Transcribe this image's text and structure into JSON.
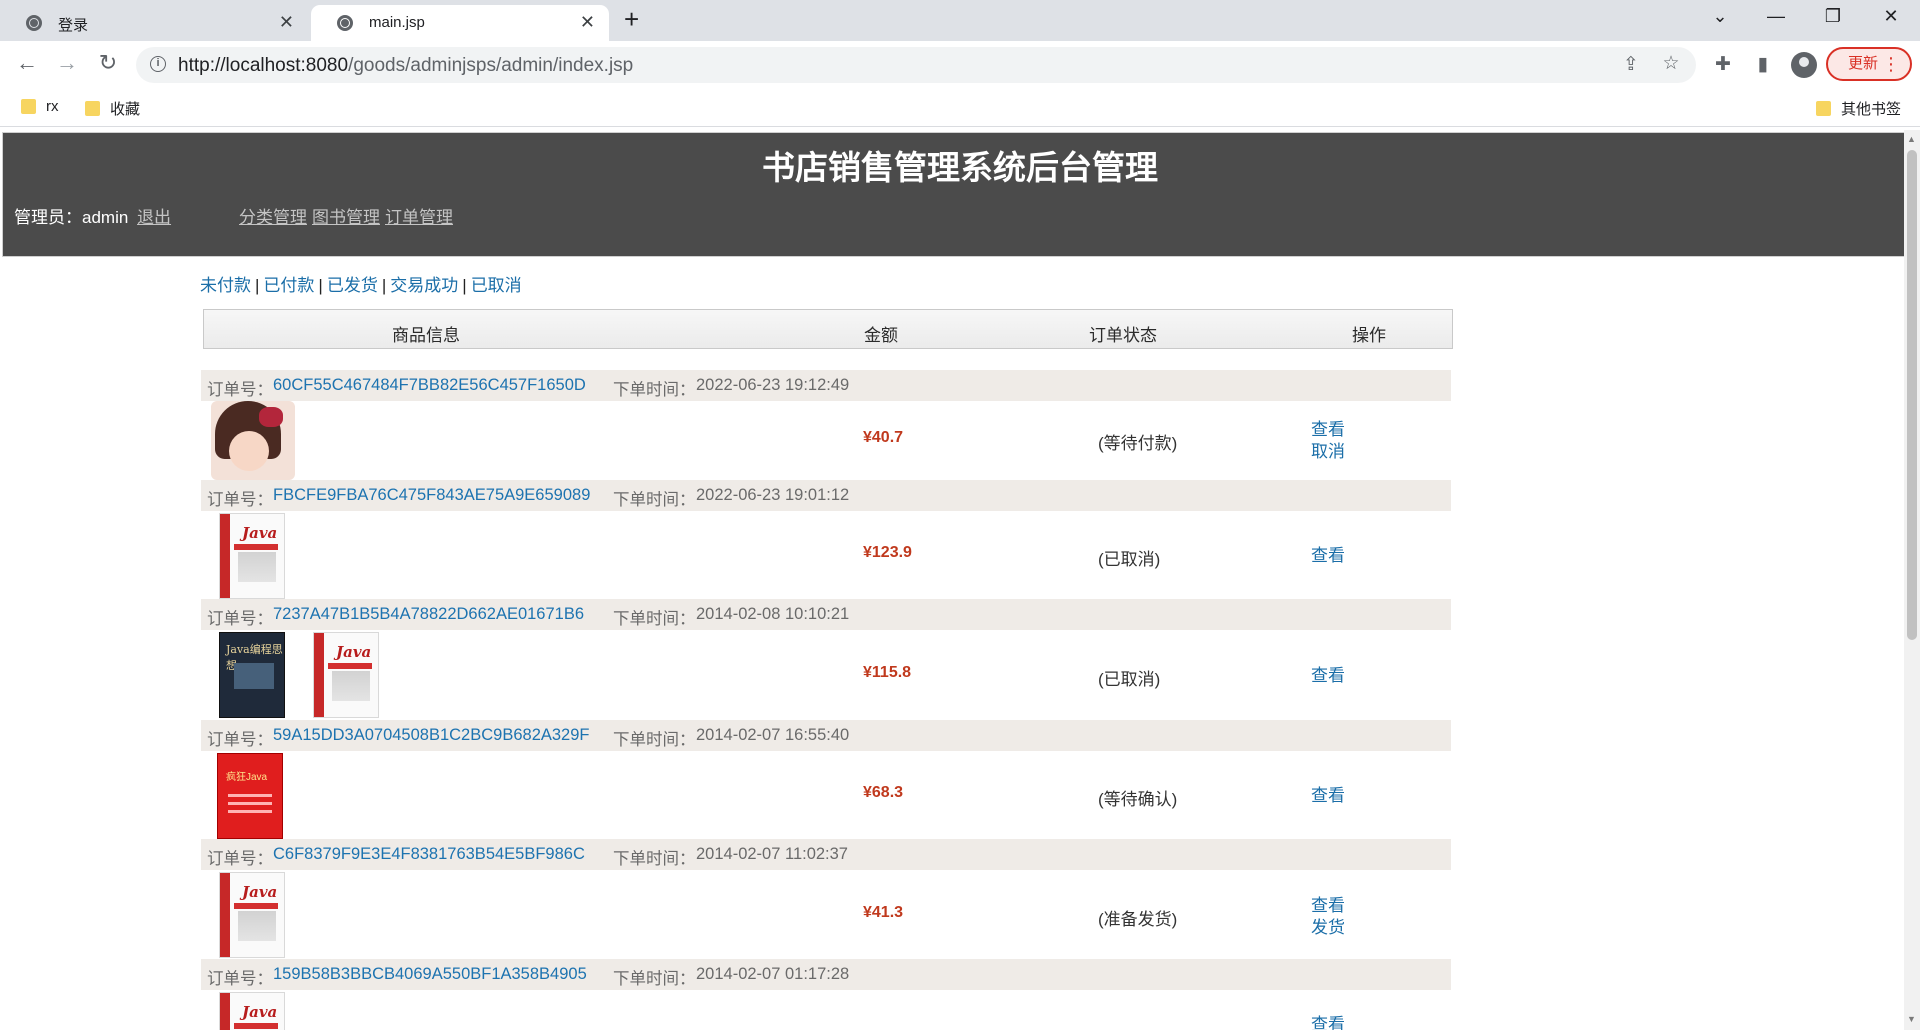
{
  "browser": {
    "tabs": [
      {
        "title": "登录"
      },
      {
        "title": "main.jsp"
      }
    ],
    "url_host": "http://localhost:8080",
    "url_path": "/goods/adminjsps/admin/index.jsp",
    "update_label": "更新",
    "bookmarks": [
      {
        "label": "rx"
      },
      {
        "label": "收藏"
      }
    ],
    "other_bookmarks": "其他书签"
  },
  "header": {
    "title": "书店销售管理系统后台管理",
    "admin_prefix": "管理员：admin",
    "logout": "退出",
    "nav": [
      {
        "label": "分类管理"
      },
      {
        "label": "图书管理"
      },
      {
        "label": "订单管理"
      }
    ]
  },
  "filters": [
    {
      "label": "未付款"
    },
    {
      "label": "已付款"
    },
    {
      "label": "已发货"
    },
    {
      "label": "交易成功"
    },
    {
      "label": "已取消"
    }
  ],
  "table": {
    "columns": [
      "商品信息",
      "金额",
      "订单状态",
      "操作"
    ]
  },
  "order_labels": {
    "order_no": "订单号：",
    "order_time": "下单时间："
  },
  "orders": [
    {
      "id": "60CF55C467484F7BB82E56C457F1650D",
      "time": "2022-06-23 19:12:49",
      "price": "¥40.7",
      "status": "(等待付款)",
      "actions": [
        "查看",
        "取消"
      ],
      "covers": [
        "girl"
      ]
    },
    {
      "id": "FBCFE9FBA76C475F843AE75A9E659089",
      "time": "2022-06-23 19:01:12",
      "price": "¥123.9",
      "status": "(已取消)",
      "actions": [
        "查看"
      ],
      "covers": [
        "java"
      ]
    },
    {
      "id": "7237A47B1B5B4A78822D662AE01671B6",
      "time": "2014-02-08 10:10:21",
      "price": "¥115.8",
      "status": "(已取消)",
      "actions": [
        "查看"
      ],
      "covers": [
        "think",
        "java"
      ]
    },
    {
      "id": "59A15DD3A0704508B1C2BC9B682A329F",
      "time": "2014-02-07 16:55:40",
      "price": "¥68.3",
      "status": "(等待确认)",
      "actions": [
        "查看"
      ],
      "covers": [
        "red"
      ]
    },
    {
      "id": "C6F8379F9E3E4F8381763B54E5BF986C",
      "time": "2014-02-07 11:02:37",
      "price": "¥41.3",
      "status": "(准备发货)",
      "actions": [
        "查看",
        "发货"
      ],
      "covers": [
        "java"
      ]
    },
    {
      "id": "159B58B3BBCB4069A550BF1A358B4905",
      "time": "2014-02-07 01:17:28",
      "price": "",
      "status": "",
      "actions": [
        "查看"
      ],
      "covers": [
        "java"
      ]
    }
  ],
  "covers": {
    "java_text": "Java",
    "think_text": "Java编程思想",
    "red_text": "疯狂Java"
  }
}
